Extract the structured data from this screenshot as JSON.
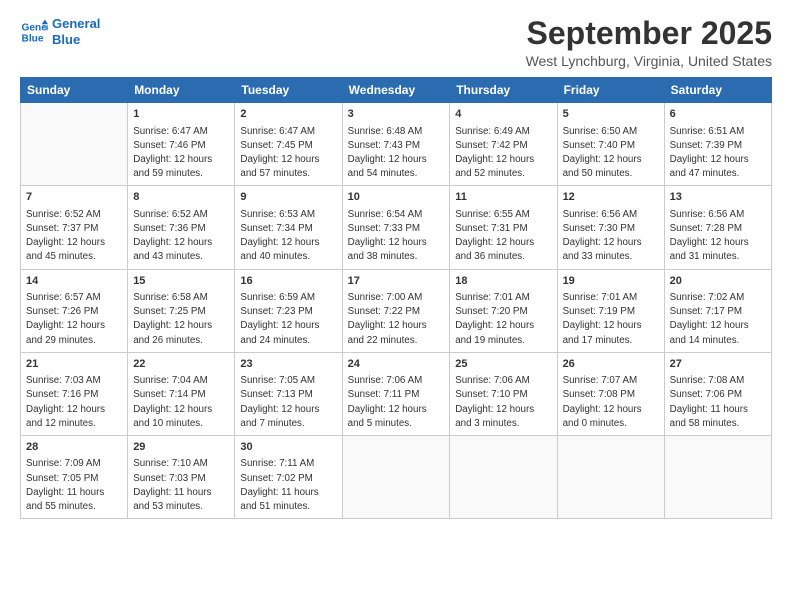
{
  "header": {
    "logo_line1": "General",
    "logo_line2": "Blue",
    "month": "September 2025",
    "location": "West Lynchburg, Virginia, United States"
  },
  "weekdays": [
    "Sunday",
    "Monday",
    "Tuesday",
    "Wednesday",
    "Thursday",
    "Friday",
    "Saturday"
  ],
  "weeks": [
    [
      {
        "day": "",
        "info": ""
      },
      {
        "day": "1",
        "info": "Sunrise: 6:47 AM\nSunset: 7:46 PM\nDaylight: 12 hours\nand 59 minutes."
      },
      {
        "day": "2",
        "info": "Sunrise: 6:47 AM\nSunset: 7:45 PM\nDaylight: 12 hours\nand 57 minutes."
      },
      {
        "day": "3",
        "info": "Sunrise: 6:48 AM\nSunset: 7:43 PM\nDaylight: 12 hours\nand 54 minutes."
      },
      {
        "day": "4",
        "info": "Sunrise: 6:49 AM\nSunset: 7:42 PM\nDaylight: 12 hours\nand 52 minutes."
      },
      {
        "day": "5",
        "info": "Sunrise: 6:50 AM\nSunset: 7:40 PM\nDaylight: 12 hours\nand 50 minutes."
      },
      {
        "day": "6",
        "info": "Sunrise: 6:51 AM\nSunset: 7:39 PM\nDaylight: 12 hours\nand 47 minutes."
      }
    ],
    [
      {
        "day": "7",
        "info": "Sunrise: 6:52 AM\nSunset: 7:37 PM\nDaylight: 12 hours\nand 45 minutes."
      },
      {
        "day": "8",
        "info": "Sunrise: 6:52 AM\nSunset: 7:36 PM\nDaylight: 12 hours\nand 43 minutes."
      },
      {
        "day": "9",
        "info": "Sunrise: 6:53 AM\nSunset: 7:34 PM\nDaylight: 12 hours\nand 40 minutes."
      },
      {
        "day": "10",
        "info": "Sunrise: 6:54 AM\nSunset: 7:33 PM\nDaylight: 12 hours\nand 38 minutes."
      },
      {
        "day": "11",
        "info": "Sunrise: 6:55 AM\nSunset: 7:31 PM\nDaylight: 12 hours\nand 36 minutes."
      },
      {
        "day": "12",
        "info": "Sunrise: 6:56 AM\nSunset: 7:30 PM\nDaylight: 12 hours\nand 33 minutes."
      },
      {
        "day": "13",
        "info": "Sunrise: 6:56 AM\nSunset: 7:28 PM\nDaylight: 12 hours\nand 31 minutes."
      }
    ],
    [
      {
        "day": "14",
        "info": "Sunrise: 6:57 AM\nSunset: 7:26 PM\nDaylight: 12 hours\nand 29 minutes."
      },
      {
        "day": "15",
        "info": "Sunrise: 6:58 AM\nSunset: 7:25 PM\nDaylight: 12 hours\nand 26 minutes."
      },
      {
        "day": "16",
        "info": "Sunrise: 6:59 AM\nSunset: 7:23 PM\nDaylight: 12 hours\nand 24 minutes."
      },
      {
        "day": "17",
        "info": "Sunrise: 7:00 AM\nSunset: 7:22 PM\nDaylight: 12 hours\nand 22 minutes."
      },
      {
        "day": "18",
        "info": "Sunrise: 7:01 AM\nSunset: 7:20 PM\nDaylight: 12 hours\nand 19 minutes."
      },
      {
        "day": "19",
        "info": "Sunrise: 7:01 AM\nSunset: 7:19 PM\nDaylight: 12 hours\nand 17 minutes."
      },
      {
        "day": "20",
        "info": "Sunrise: 7:02 AM\nSunset: 7:17 PM\nDaylight: 12 hours\nand 14 minutes."
      }
    ],
    [
      {
        "day": "21",
        "info": "Sunrise: 7:03 AM\nSunset: 7:16 PM\nDaylight: 12 hours\nand 12 minutes."
      },
      {
        "day": "22",
        "info": "Sunrise: 7:04 AM\nSunset: 7:14 PM\nDaylight: 12 hours\nand 10 minutes."
      },
      {
        "day": "23",
        "info": "Sunrise: 7:05 AM\nSunset: 7:13 PM\nDaylight: 12 hours\nand 7 minutes."
      },
      {
        "day": "24",
        "info": "Sunrise: 7:06 AM\nSunset: 7:11 PM\nDaylight: 12 hours\nand 5 minutes."
      },
      {
        "day": "25",
        "info": "Sunrise: 7:06 AM\nSunset: 7:10 PM\nDaylight: 12 hours\nand 3 minutes."
      },
      {
        "day": "26",
        "info": "Sunrise: 7:07 AM\nSunset: 7:08 PM\nDaylight: 12 hours\nand 0 minutes."
      },
      {
        "day": "27",
        "info": "Sunrise: 7:08 AM\nSunset: 7:06 PM\nDaylight: 11 hours\nand 58 minutes."
      }
    ],
    [
      {
        "day": "28",
        "info": "Sunrise: 7:09 AM\nSunset: 7:05 PM\nDaylight: 11 hours\nand 55 minutes."
      },
      {
        "day": "29",
        "info": "Sunrise: 7:10 AM\nSunset: 7:03 PM\nDaylight: 11 hours\nand 53 minutes."
      },
      {
        "day": "30",
        "info": "Sunrise: 7:11 AM\nSunset: 7:02 PM\nDaylight: 11 hours\nand 51 minutes."
      },
      {
        "day": "",
        "info": ""
      },
      {
        "day": "",
        "info": ""
      },
      {
        "day": "",
        "info": ""
      },
      {
        "day": "",
        "info": ""
      }
    ]
  ]
}
